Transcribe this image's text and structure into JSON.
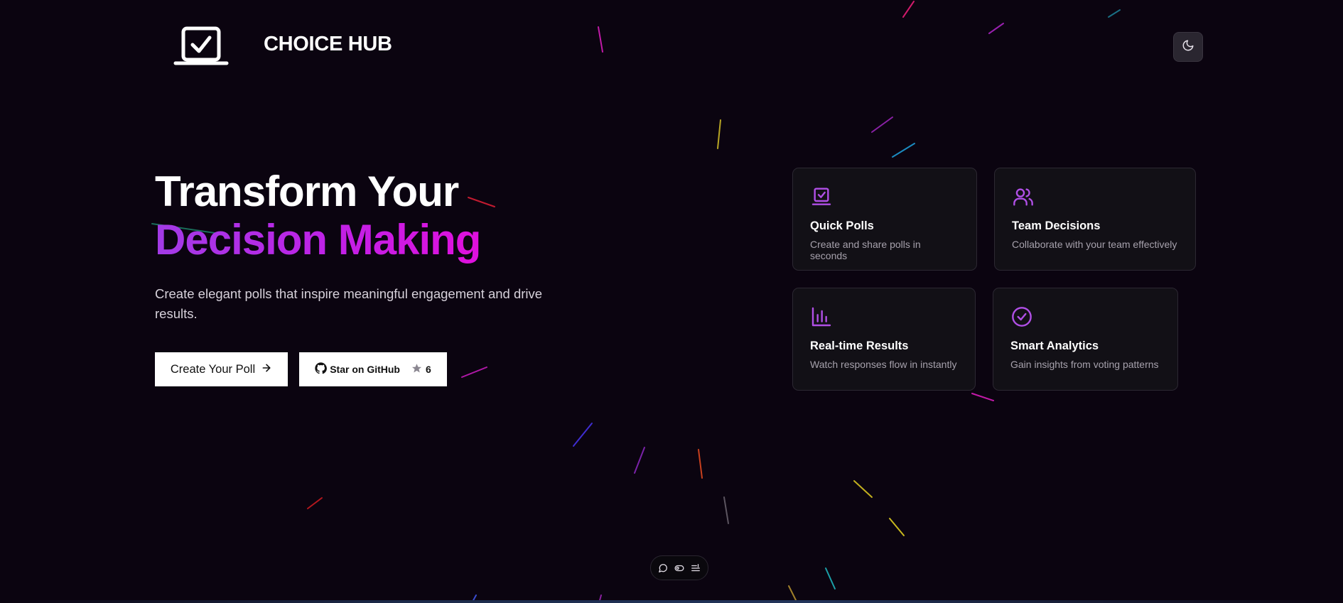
{
  "header": {
    "brand": "CHOICE HUB",
    "logo_icon": "laptop-check-icon",
    "theme_toggle_icon": "moon-icon"
  },
  "hero": {
    "title_line1": "Transform Your",
    "title_line2": "Decision Making",
    "subtitle": "Create elegant polls that inspire meaningful engagement and drive results.",
    "primary_button": {
      "label": "Create Your Poll",
      "icon": "arrow-right-icon"
    },
    "github_button": {
      "label": "Star on GitHub",
      "icon": "github-icon",
      "star_icon": "star-icon",
      "star_count": "6"
    }
  },
  "features": [
    {
      "title": "Quick Polls",
      "description": "Create and share polls in seconds",
      "icon": "laptop-check-icon"
    },
    {
      "title": "Team Decisions",
      "description": "Collaborate with your team effectively",
      "icon": "users-icon"
    },
    {
      "title": "Real-time Results",
      "description": "Watch responses flow in instantly",
      "icon": "bar-chart-icon"
    },
    {
      "title": "Smart Analytics",
      "description": "Gain insights from voting patterns",
      "icon": "check-circle-icon"
    }
  ],
  "toolbar": {
    "icons": [
      "chat-bubble-icon",
      "toggle-icon",
      "list-icon"
    ]
  },
  "colors": {
    "background": "#0b0410",
    "accent_purple": "#a23be6",
    "accent_magenta": "#e010dd",
    "card_background": "#121016",
    "card_border": "#2c2832",
    "muted_text": "#a6a1ac"
  }
}
